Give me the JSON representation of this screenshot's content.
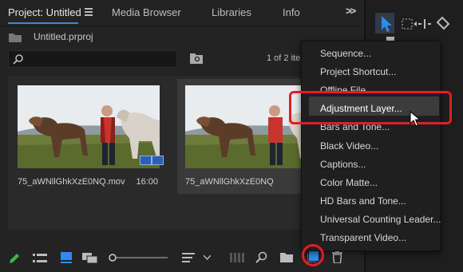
{
  "tabs": {
    "project": "Project: Untitled",
    "media_browser": "Media Browser",
    "libraries": "Libraries",
    "info": "Info",
    "more": ">>"
  },
  "project": {
    "file": "Untitled.prproj",
    "items_count": "1 of 2 ite"
  },
  "clips": [
    {
      "name": "75_aWNllGhkXzE0NQ.mov",
      "duration": "16:00"
    },
    {
      "name": "75_aWNllGhkXzE0NQ"
    }
  ],
  "new_item_menu": {
    "items": [
      "Sequence...",
      "Project Shortcut...",
      "Offline File...",
      "Adjustment Layer...",
      "Bars and Tone...",
      "Black Video...",
      "Captions...",
      "Color Matte...",
      "HD Bars and Tone...",
      "Universal Counting Leader...",
      "Transparent Video..."
    ],
    "highlighted_index": 3
  },
  "colors": {
    "accent": "#2d8ceb",
    "highlight_red": "#e21d24"
  }
}
